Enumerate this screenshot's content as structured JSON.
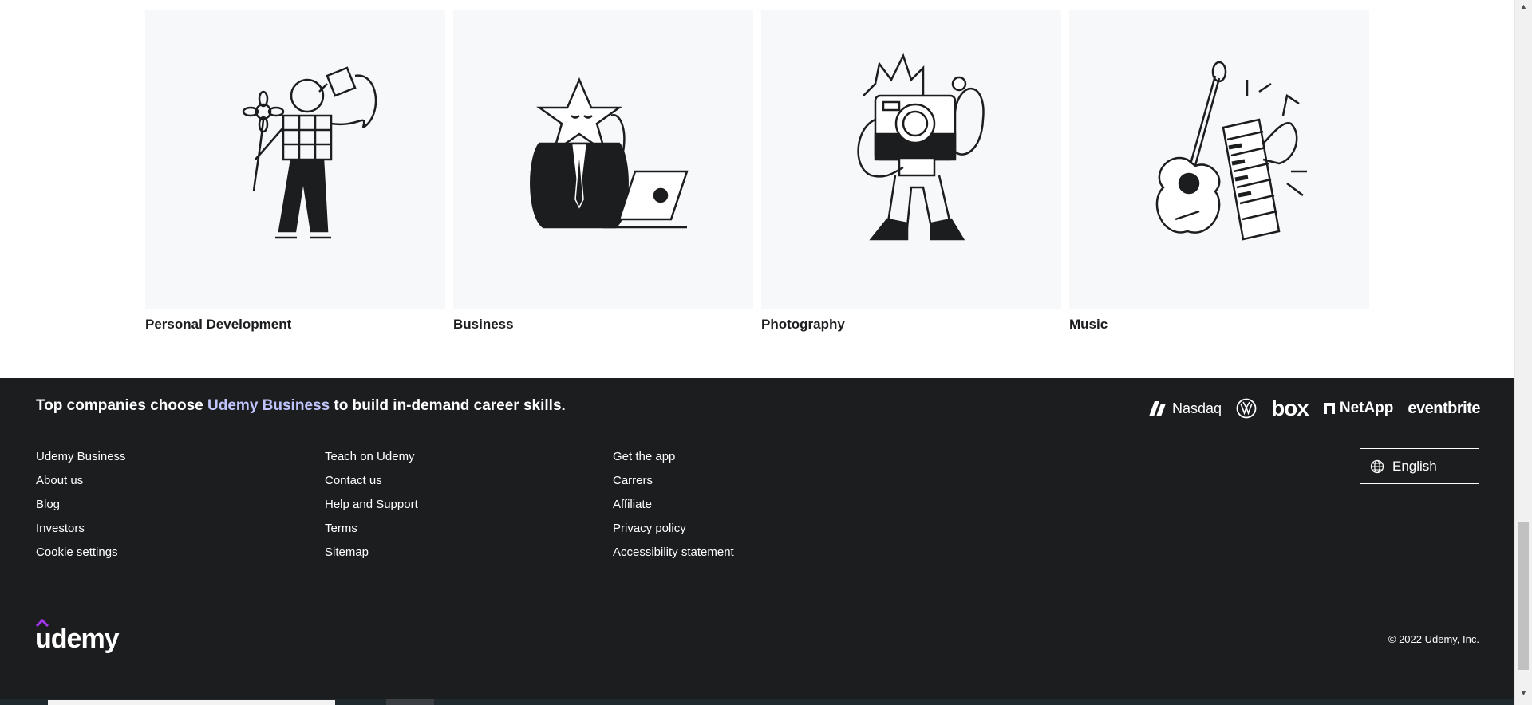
{
  "categories": [
    {
      "label": "Personal Development",
      "icon": "person-watering-flower-illustration"
    },
    {
      "label": "Business",
      "icon": "star-businessman-laptop-illustration"
    },
    {
      "label": "Photography",
      "icon": "camera-character-illustration"
    },
    {
      "label": "Music",
      "icon": "guitar-piano-illustration"
    }
  ],
  "footer": {
    "tagline": {
      "prefix": "Top companies choose ",
      "highlight": "Udemy Business",
      "suffix": " to build in-demand career skills."
    },
    "company_logos": {
      "nasdaq": "Nasdaq",
      "volkswagen": "VW",
      "box": "box",
      "netapp": "NetApp",
      "eventbrite": "eventbrite"
    },
    "columns": [
      [
        "Udemy Business",
        "About us",
        "Blog",
        "Investors",
        "Cookie settings"
      ],
      [
        "Teach on Udemy",
        "Contact us",
        "Help and Support",
        "Terms",
        "Sitemap"
      ],
      [
        "Get the app",
        "Carrers",
        "Affiliate",
        "Privacy policy",
        "Accessibility statement"
      ]
    ],
    "language_button": "English",
    "brand": "udemy",
    "copyright": "© 2022 Udemy, Inc.",
    "colors": {
      "background": "#1c1d1f",
      "highlight": "#c0c4fc",
      "brand_accent": "#a435f0"
    }
  }
}
